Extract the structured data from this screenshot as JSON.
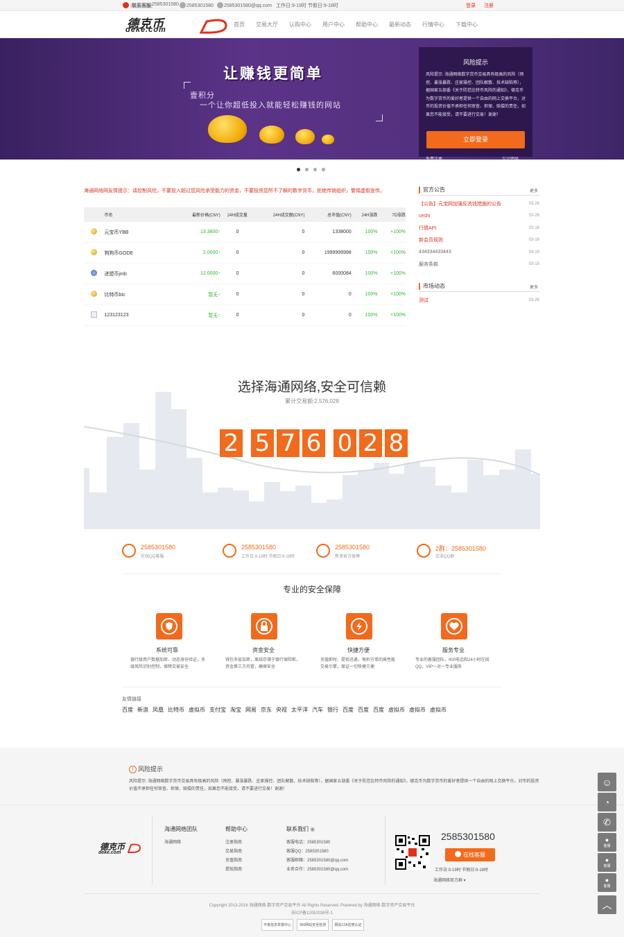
{
  "topbar": {
    "contact_label": "联系客服",
    "qq": "2585301580",
    "phone": "2585301580",
    "email": "2585301580@qq.com",
    "hours": "工作日:9-19时 节假日:9-18时",
    "login": "登录",
    "register": "注册"
  },
  "header": {
    "logo_cn": "德克币",
    "logo_en": "deke.com",
    "nav": [
      "首页",
      "交易大厅",
      "认购中心",
      "用户中心",
      "帮助中心",
      "最新动态",
      "行情中心",
      "下载中心"
    ]
  },
  "banner": {
    "title": "让赚钱更简单",
    "sub1": "壹积分",
    "sub2": "一个让你超低投入就能轻松赚钱的网站",
    "risk_title": "风险提示",
    "risk_text": "风险提示: 海通网络数字货币交易具有极高的风险（预挖、暴涨暴跌、庄家操控、团队解散、技术缺陷等），据国家五部委《关于防范比特币风险的通知》，德克币为数字货币的爱好者提供一个自由的网上交换平台，对币的投资价值不承担任何审查、担保、赔偿的责任，如果您不能接受，请不要进行交易！谢谢！",
    "login_btn": "立即登录",
    "free_register": "免费注册",
    "forgot": "忘记密码"
  },
  "notice": "海通网络网友情提示：请控制风险，不要投入超过您风险承受能力的资金，不要投资您所不了解的数字货币，拒绝传销组织，警惕虚假宣传。",
  "market": {
    "headers": [
      "币名",
      "最新价格(CNY)",
      "24H成交量",
      "24H成交额(CNY)",
      "总市值(CNY)",
      "24H涨跌",
      "7D涨跌"
    ],
    "rows": [
      {
        "name": "元宝币YBB",
        "price": "13.3800↑",
        "vol": "0",
        "amount": "0",
        "cap": "1338000",
        "d1": "100%",
        "d7": "+100%"
      },
      {
        "name": "狗狗币GODE",
        "price": "2.0000↑",
        "vol": "0",
        "amount": "0",
        "cap": "1999999998",
        "d1": "100%",
        "d7": "+100%"
      },
      {
        "name": "进盟币jmb",
        "price": "12.0000↑",
        "vol": "0",
        "amount": "0",
        "cap": "6000084",
        "d1": "100%",
        "d7": "+100%"
      },
      {
        "name": "比特币btc",
        "price": "暂无↑",
        "vol": "0",
        "amount": "0",
        "cap": "0",
        "d1": "100%",
        "d7": "+100%"
      },
      {
        "name": "123123123",
        "price": "暂无↑",
        "vol": "0",
        "amount": "0",
        "cap": "0",
        "d1": "100%",
        "d7": "+100%"
      }
    ]
  },
  "announcements": {
    "title": "官方公告",
    "more": "更多",
    "items": [
      {
        "text": "【公告】元宝网加强反洗钱措施的公告",
        "date": "03-26"
      },
      {
        "text": "ceshi",
        "date": "03-26"
      },
      {
        "text": "行情API",
        "date": "03-16"
      },
      {
        "text": "新会员规则",
        "date": "03-16"
      },
      {
        "text": "434334433443",
        "date": "04-19"
      },
      {
        "text": "服务条款",
        "date": "03-15"
      }
    ]
  },
  "market_news": {
    "title": "市场动态",
    "more": "更多",
    "items": [
      {
        "text": "测试",
        "date": "03-26"
      }
    ]
  },
  "stats": {
    "title": "选择海通网络,安全可信赖",
    "subtitle": "累计交易额:2,576,028",
    "digits": [
      "2",
      "5",
      "7",
      "6",
      "0",
      "2",
      "8"
    ]
  },
  "contacts": [
    {
      "main": "2585301580",
      "sub": "在线QQ客服"
    },
    {
      "main": "2585301580",
      "sub": "工作日:9-19时 节假日:9-18时"
    },
    {
      "main": "2585301580",
      "sub": "新浪官方微博"
    },
    {
      "main": "2群：2585301580",
      "sub": "交流QQ群"
    }
  ],
  "security": {
    "title": "专业的安全保障",
    "features": [
      {
        "title": "系统可靠",
        "desc": "银行级用户数据加密、动态身份验证，多级风险识别控制，保障交易安全"
      },
      {
        "title": "资金安全",
        "desc": "钱包多层加密，离线存储于银行保险柜，资金第三方托管，确保安全"
      },
      {
        "title": "快捷方便",
        "desc": "充值即时、提现迅速，每秒万单的高性能交易引擎，保证一切快捷方便"
      },
      {
        "title": "服务专业",
        "desc": "专业的客服团队，400电话和24小时在线QQ，VIP一对一专业服务"
      }
    ]
  },
  "friends": {
    "title": "友情链接",
    "links": [
      "百度",
      "新浪",
      "凤凰",
      "比特币",
      "虚拟币",
      "支付宝",
      "淘宝",
      "网易",
      "京东",
      "央视",
      "太平洋",
      "汽车",
      "银行",
      "百度",
      "百度",
      "百度",
      "虚拟币",
      "虚拟币",
      "虚拟币"
    ]
  },
  "risk_footer": {
    "title": "风险提示",
    "text": "风险提示: 海通网络数字货币交易具有极高的风险（预挖、暴涨暴跌、庄家操控、团队解散、技术缺陷等），据国家五部委《关于防范比特币风险的通知》，德克币为数字货币的爱好者提供一个自由的网上交换平台，对币的投资价值不承担任何审查、担保、赔偿的责任，如果您不能接受，请不要进行交易！谢谢！"
  },
  "footer": {
    "logo_cn": "德克币",
    "logo_en": "deke.com",
    "team_title": "海通网络团队",
    "team_items": [
      "海通网络"
    ],
    "help_title": "帮助中心",
    "help_items": [
      "注册指南",
      "交易指南",
      "充值指南",
      "提现指南"
    ],
    "contact_title": "联系我们",
    "contact_items": [
      "客服电话：2585301580",
      "客服QQ：2585301580",
      "客服邮箱：2585301580@qq.com",
      "业务合作：2585301580@qq.com"
    ],
    "phone": "2585301580",
    "online": "在线客服",
    "work": "工作日:9-19时 节假日:9-18时",
    "official": "海通网络官方群",
    "copyright": "Copyright 2013-2016 海通网络-数字资产交易平台 All Rights Reserved. Powered by 海通网络-数字资产交易平台",
    "icp": "苏ICP备12052038号-1",
    "badges": [
      "不良信息举报中心",
      "360网站安全检测",
      "网站12A信誉认证"
    ]
  },
  "floaters": [
    "客服",
    "微信",
    "电话",
    "客服",
    "客服",
    "顶部"
  ]
}
